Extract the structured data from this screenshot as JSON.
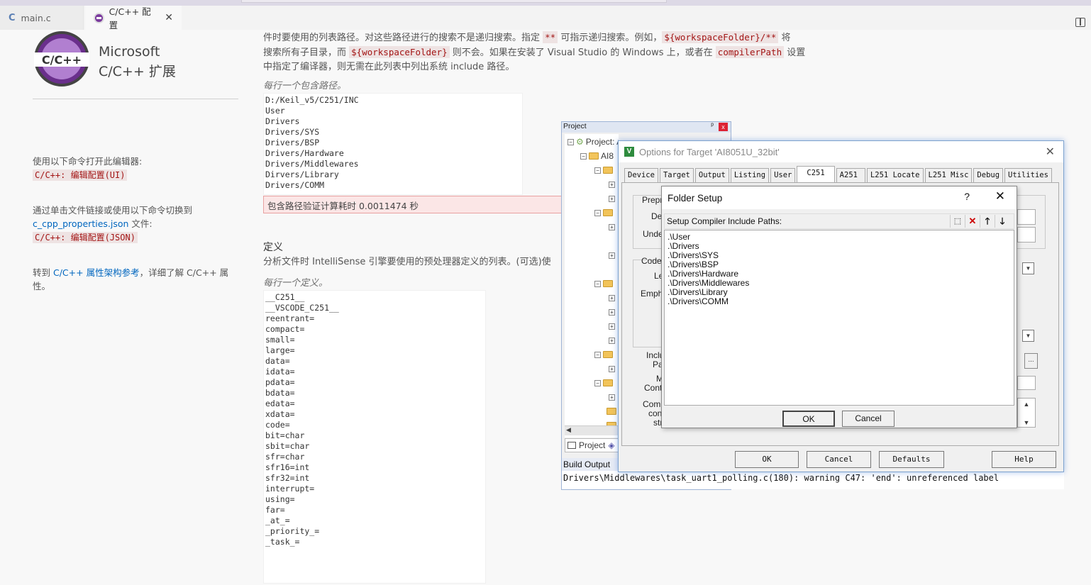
{
  "tabs": [
    {
      "label": "main.c",
      "icon": "c-file-icon"
    },
    {
      "label": "C/C++ 配置",
      "icon": "cpp-extension-icon"
    }
  ],
  "sidebar": {
    "logo_text": "C/C++",
    "brand_line1": "Microsoft",
    "brand_line2": "C/C++ 扩展",
    "open_editor_text": "使用以下命令打开此编辑器:",
    "open_editor_cmd": "C/C++: 编辑配置(UI)",
    "switch_text1": "通过单击文件链接或使用以下命令切换到",
    "switch_link": "c_cpp_properties.json",
    "switch_text2": " 文件:",
    "switch_cmd": "C/C++: 编辑配置(JSON)",
    "schema_prefix": "转到 ",
    "schema_link": "C/C++ 属性架构参考",
    "schema_suffix": "，详细了解 C/C++ 属",
    "schema_suffix2": "性。"
  },
  "include": {
    "desc_line1_a": "件时要使用的列表路径。对这些路径进行的搜索不是递归搜索。指定 ",
    "desc_code1": "**",
    "desc_line1_b": " 可指示递归搜索。例如，",
    "desc_code2": "${workspaceFolder}/**",
    "desc_line1_c": " 将",
    "desc_line2_a": "搜索所有子目录，而 ",
    "desc_code3": "${workspaceFolder}",
    "desc_line2_b": " 则不会。如果在安装了 Visual Studio 的 Windows 上，或者在 ",
    "desc_code4": "compilerPath",
    "desc_line2_c": " 设置",
    "desc_line3": "中指定了编译器，则无需在此列表中列出系统 include 路径。",
    "hint": "每行一个包含路径。",
    "paths": "D:/Keil_v5/C251/INC\nUser\nDrivers\nDrivers/SYS\nDrivers/BSP\nDrivers/Hardware\nDrivers/Middlewares\nDirvers/Library\nDrivers/COMM",
    "validation": "包含路径验证计算耗时 0.0011474 秒"
  },
  "defines": {
    "heading": "定义",
    "desc": "分析文件时 IntelliSense 引擎要使用的预处理器定义的列表。(可选)使",
    "hint": "每行一个定义。",
    "values": "__C251__\n__VSCODE_C251__\nreentrant=\ncompact=\nsmall=\nlarge=\ndata=\nidata=\npdata=\nbdata=\nedata=\nxdata=\ncode=\nbit=char\nsbit=char\nsfr=char\nsfr16=int\nsfr32=int\ninterrupt=\nusing=\nfar=\n_at_=\n_priority_=\n_task_="
  },
  "keil_project": {
    "caption": "Project",
    "pin": "ᵖ",
    "close": "x",
    "root": "Project: AI8051U_C251",
    "target": "AI8",
    "project_tab": "Project",
    "build_output_caption": "Build Output",
    "build_output": "Drivers\\Middlewares\\task_uart1_polling.c(180): warning C47: 'end': unreferenced label"
  },
  "options_dialog": {
    "title": "Options for Target 'AI8051U_32bit'",
    "close": "✕",
    "tabs": [
      "Device",
      "Target",
      "Output",
      "Listing",
      "User",
      "C251",
      "A251",
      "L251 Locate",
      "L251 Misc",
      "Debug",
      "Utilities"
    ],
    "selected_tab": "C251",
    "labels": [
      "Prepro",
      "Def",
      "Undef",
      "Code",
      "Le",
      "Empha",
      "Inclu",
      "Pa",
      "M",
      "Contr",
      "Comp",
      "con",
      "stri"
    ],
    "ellipsis": "...",
    "buttons": [
      "OK",
      "Cancel",
      "Defaults",
      "Help"
    ]
  },
  "folder_setup": {
    "title": "Folder Setup",
    "help": "?",
    "close": "✕",
    "label": "Setup Compiler Include Paths:",
    "paths": [
      ".\\User",
      ".\\Drivers",
      ".\\Drivers\\SYS",
      ".\\Drivers\\BSP",
      ".\\Drivers\\Hardware",
      ".\\Drivers\\Middlewares",
      ".\\Dirvers\\Library",
      ".\\Drivers\\COMM"
    ],
    "ok": "OK",
    "cancel": "Cancel"
  },
  "colors": {
    "code_text": "#a31515",
    "link": "#0066bf",
    "error_bg": "#fbe6e6",
    "logo_purple": "#6a2f8c"
  }
}
